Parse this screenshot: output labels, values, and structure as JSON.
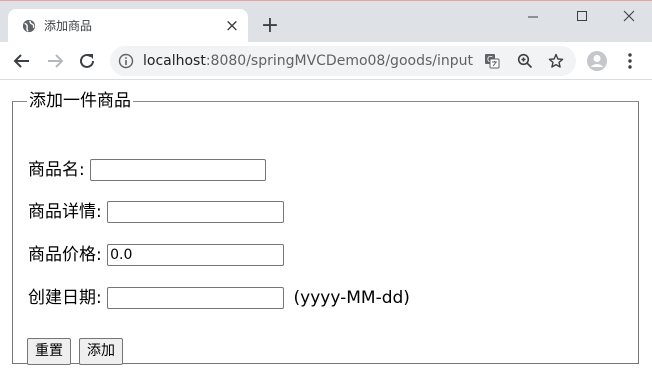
{
  "browser": {
    "tab_title": "添加商品",
    "url_host": "localhost",
    "url_rest": ":8080/springMVCDemo08/goods/input"
  },
  "form": {
    "legend": "添加一件商品",
    "fields": {
      "name": {
        "label": "商品名:",
        "value": ""
      },
      "detail": {
        "label": "商品详情:",
        "value": ""
      },
      "price": {
        "label": "商品价格:",
        "value": "0.0"
      },
      "date": {
        "label": "创建日期:",
        "value": "",
        "hint": "(yyyy-MM-dd)"
      }
    },
    "reset_label": "重置",
    "submit_label": "添加"
  }
}
